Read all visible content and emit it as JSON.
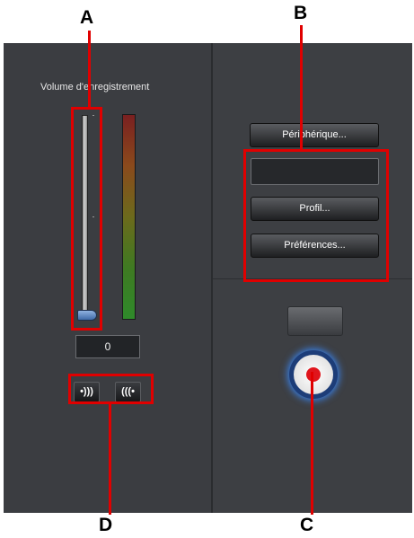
{
  "recorder": {
    "volume_title": "Volume d'enregistrement",
    "volume_level_percent": 0,
    "volume_value": "0",
    "monitor_buttons": [
      {
        "name": "monitor-output-icon",
        "glyph": "•)))"
      },
      {
        "name": "monitor-input-icon",
        "glyph": "(((•"
      }
    ],
    "device_button": "Périphérique...",
    "device_field": "",
    "profile_button": "Profil...",
    "prefs_button": "Préférences..."
  },
  "callouts": {
    "a": "A",
    "b": "B",
    "c": "C",
    "d": "D"
  },
  "colors": {
    "highlight": "#e00000",
    "record_red": "#e0151c",
    "panel_bg": "#3c3e42"
  }
}
